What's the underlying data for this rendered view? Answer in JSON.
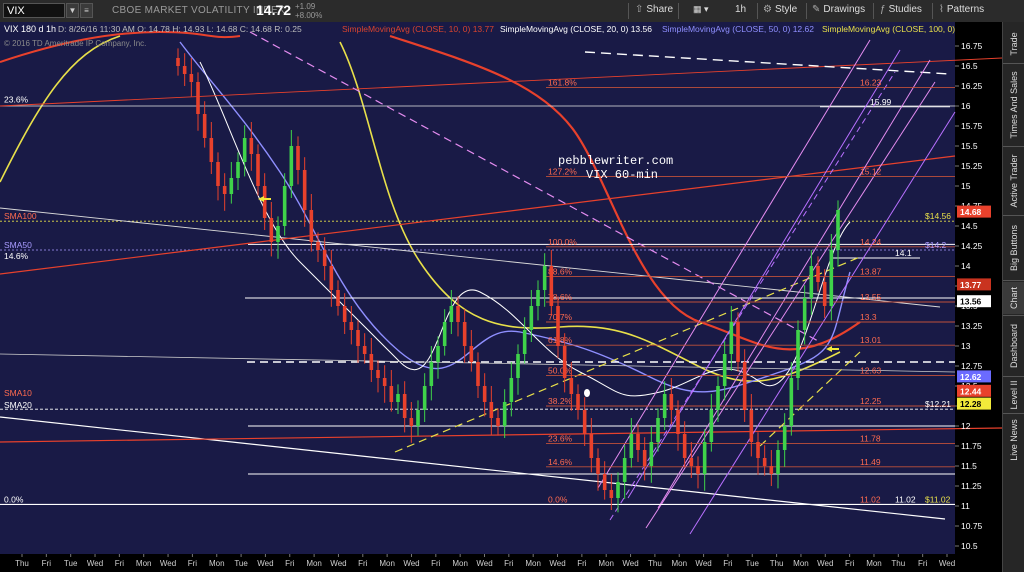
{
  "toolbar": {
    "symbol": "VIX",
    "description": "CBOE MARKET VOLATILITY INDEX",
    "price": "14.72",
    "change": "+1.09",
    "change_pct": "+8.00%",
    "interval": "1h",
    "buttons": [
      "Share",
      "Style",
      "Drawings",
      "Studies",
      "Patterns"
    ]
  },
  "chart_header": {
    "title": "VIX 180 d 1h",
    "details": "D: 8/26/16 11:30 AM  O: 14.78  H: 14.93  L: 14.68  C: 14.68  R: 0.25",
    "copyright": "© 2016 TD Ameritrade IP Company, Inc.",
    "studies": [
      {
        "label": "SimpleMovingAvg (CLOSE, 10, 0)",
        "value": "13.77",
        "color": "#d9442f"
      },
      {
        "label": "SimpleMovingAvg (CLOSE, 20, 0)",
        "value": "13.56",
        "color": "#ffffff"
      },
      {
        "label": "SimpleMovingAvg (CLOSE, 50, 0)",
        "value": "12.62",
        "color": "#8f8fff"
      },
      {
        "label": "SimpleMovingAvg (CLOSE, 100, 0)",
        "value": "",
        "color": "#e8e04a"
      }
    ]
  },
  "sidebar_tabs": [
    "Trade",
    "Times And Sales",
    "Active Trader",
    "Big Buttons",
    "Chart",
    "Dashboard",
    "Level II",
    "Live News"
  ],
  "chart_data": {
    "type": "candlestick",
    "symbol": "VIX",
    "annotation": [
      "pebblewriter.com",
      "VIX 60-min"
    ],
    "ylim": [
      10.5,
      16.875
    ],
    "y_ticks": [
      "16.75",
      "16.5",
      "16.25",
      "16",
      "15.75",
      "15.5",
      "15.25",
      "15",
      "14.75",
      "14.5",
      "14.25",
      "14",
      "13.75",
      "13.5",
      "13.25",
      "13",
      "12.75",
      "12.5",
      "12.25",
      "12",
      "11.75",
      "11.5",
      "11.25",
      "11",
      "10.75",
      "10.5"
    ],
    "x_ticks": [
      "Thu",
      "Fri",
      "Tue",
      "Wed",
      "Fri",
      "Mon",
      "Wed",
      "Fri",
      "Mon",
      "Tue",
      "Wed",
      "Fri",
      "Mon",
      "Wed",
      "Fri",
      "Mon",
      "Wed",
      "Fri",
      "Mon",
      "Wed",
      "Fri",
      "Mon",
      "Wed",
      "Fri",
      "Mon",
      "Wed",
      "Thu",
      "Mon",
      "Wed",
      "Fri",
      "Tue",
      "Thu",
      "Mon",
      "Wed",
      "Fri",
      "Mon",
      "Thu",
      "Fri",
      "Wed"
    ],
    "price_tags": [
      {
        "label": "14.68",
        "value": 14.68,
        "color": "#e8412c",
        "text_color": "#ffffff"
      },
      {
        "label": "13.77",
        "value": 13.77,
        "color": "#c9331f",
        "text_color": "#ffffff"
      },
      {
        "label": "13.56",
        "value": 13.56,
        "color": "#ffffff",
        "text_color": "#000000"
      },
      {
        "label": "12.62",
        "value": 12.62,
        "color": "#6b6bff",
        "text_color": "#ffffff"
      },
      {
        "label": "12.44",
        "value": 12.44,
        "color": "#e8412c",
        "text_color": "#ffffff"
      },
      {
        "label": "12.28",
        "value": 12.28,
        "color": "#f2ea3a",
        "text_color": "#000000"
      }
    ],
    "fib_left": [
      {
        "label": "161.8%",
        "value": 16.23
      },
      {
        "label": "127.2%",
        "value": 15.12
      },
      {
        "label": "100.0%",
        "value": 14.24
      },
      {
        "label": "88.6%",
        "value": 13.87
      },
      {
        "label": "78.6%",
        "value": 13.55
      },
      {
        "label": "70.7%",
        "value": 13.3
      },
      {
        "label": "61.8%",
        "value": 13.01
      },
      {
        "label": "50.0%",
        "value": 12.63
      },
      {
        "label": "38.2%",
        "value": 12.25
      },
      {
        "label": "23.6%",
        "value": 11.78
      },
      {
        "label": "14.6%",
        "value": 11.49
      },
      {
        "label": "0.0%",
        "value": 11.02
      }
    ],
    "fib_right": [
      "16.23",
      "15.12",
      "14.24",
      "13.87",
      "13.55",
      "13.3",
      "13.01",
      "12.63",
      "12.25",
      "11.78",
      "11.49",
      "11.02"
    ],
    "levels": [
      {
        "label": "15.99",
        "value": 15.99
      },
      {
        "label": "14.1",
        "value": 14.1
      },
      {
        "label": "11.02",
        "value": 11.02
      }
    ],
    "left_labels": [
      {
        "label": "23.6%",
        "value": 16.02
      },
      {
        "label": "SMA100",
        "value": 14.56
      },
      {
        "label": "SMA50",
        "value": 14.2
      },
      {
        "label": "14.6%",
        "value": 14.06
      },
      {
        "label": "SMA10",
        "value": 12.35
      },
      {
        "label": "SMA20",
        "value": 12.2
      },
      {
        "label": "0.0%",
        "value": 11.02
      }
    ],
    "ma_values": [
      {
        "label": "$14.56",
        "value": 14.56,
        "color": "#e8e04a"
      },
      {
        "label": "$14.2",
        "value": 14.2,
        "color": "#a99cff"
      },
      {
        "label": "$12.21",
        "value": 12.21,
        "color": "#ffffff"
      },
      {
        "label": "$11.02",
        "value": 11.02,
        "color": "#e8e04a"
      }
    ],
    "closes": [
      16.5,
      16.4,
      16.3,
      15.9,
      15.6,
      15.3,
      15.0,
      14.9,
      15.1,
      15.3,
      15.6,
      15.4,
      15.0,
      14.6,
      14.3,
      14.5,
      15.0,
      15.5,
      15.2,
      14.7,
      14.3,
      14.2,
      14.0,
      13.7,
      13.5,
      13.3,
      13.2,
      13.0,
      12.9,
      12.7,
      12.6,
      12.5,
      12.3,
      12.4,
      12.1,
      12.0,
      12.2,
      12.5,
      12.8,
      13.0,
      13.3,
      13.5,
      13.3,
      13.0,
      12.8,
      12.5,
      12.3,
      12.1,
      12.0,
      12.3,
      12.6,
      12.9,
      13.2,
      13.5,
      13.7,
      14.0,
      13.5,
      13.0,
      12.6,
      12.4,
      12.2,
      11.9,
      11.6,
      11.4,
      11.2,
      11.1,
      11.3,
      11.6,
      11.9,
      11.7,
      11.5,
      11.8,
      12.1,
      12.4,
      12.2,
      11.9,
      11.6,
      11.5,
      11.4,
      11.8,
      12.2,
      12.5,
      12.9,
      13.3,
      12.8,
      12.2,
      11.8,
      11.6,
      11.5,
      11.4,
      11.7,
      12.0,
      12.6,
      13.2,
      13.6,
      14.0,
      13.8,
      13.5,
      14.2,
      14.7
    ]
  }
}
